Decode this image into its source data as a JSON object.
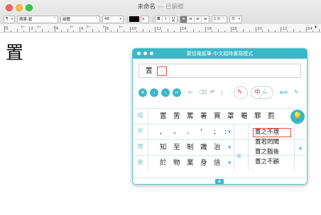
{
  "window": {
    "title": "未命名",
    "edited": "— 已編輯"
  },
  "format_bar": {
    "paragraph_style": "¶",
    "font_family": "蘋果-繁",
    "font_style": "細體",
    "font_size": "48",
    "bold": "B",
    "italic": "I",
    "underline": "U",
    "line_spacing": "1.0",
    "list": "☰"
  },
  "ruler": {
    "numbers": [
      "0",
      "2",
      "4",
      "6",
      "8",
      "10",
      "12",
      "14",
      "16",
      "18",
      "20",
      "22",
      "24"
    ]
  },
  "document": {
    "text": "置"
  },
  "ime_panel": {
    "title": "蒙恬電紙筆-中文超時書寫模式",
    "input_char": "置",
    "mode_zh": "中",
    "mode_en": "En",
    "row_labels": [
      "候",
      "半",
      "常",
      "後"
    ],
    "candidates": [
      "置",
      "罟",
      "罵",
      "署",
      "買",
      "罩",
      "罨",
      "罪",
      "罰"
    ],
    "punctuation": [
      ",",
      "、",
      ".",
      "'",
      ";",
      ":"
    ],
    "common_words": [
      "知",
      "至",
      "制",
      "識",
      "治"
    ],
    "next_words": [
      "於",
      "物",
      "業",
      "身",
      "信"
    ],
    "phrases": [
      "置之不理",
      "置若罔聞",
      "置之腦後",
      "置之不顧"
    ],
    "biaohao_label": "標",
    "colors": {
      "accent": "#3ab8c6",
      "highlight": "#f04d3d"
    }
  }
}
